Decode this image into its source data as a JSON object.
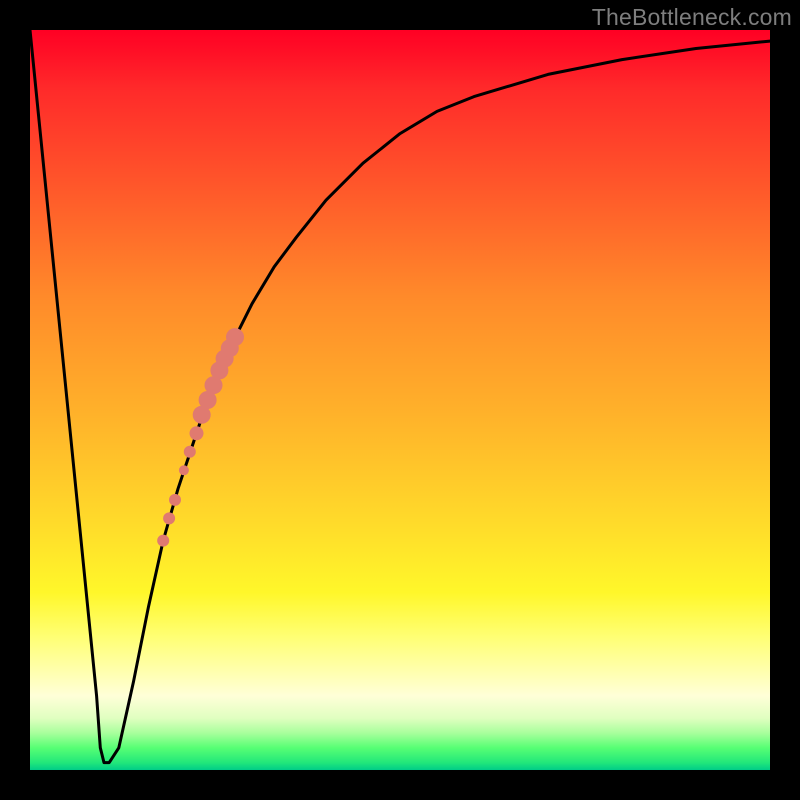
{
  "watermark": "TheBottleneck.com",
  "chart_data": {
    "type": "line",
    "title": "",
    "xlabel": "",
    "ylabel": "",
    "x_range": [
      0,
      100
    ],
    "y_range": [
      0,
      100
    ],
    "series": [
      {
        "name": "bottleneck-curve",
        "color": "#000000",
        "x": [
          0,
          2,
          5,
          8,
          9,
          9.5,
          10,
          10.7,
          12,
          14,
          16,
          18,
          20,
          22,
          24,
          26,
          28,
          30,
          33,
          36,
          40,
          45,
          50,
          55,
          60,
          70,
          80,
          90,
          100
        ],
        "y": [
          100,
          80,
          50,
          20,
          10,
          3,
          1,
          1,
          3,
          12,
          22,
          31,
          38,
          44,
          50,
          55,
          59,
          63,
          68,
          72,
          77,
          82,
          86,
          89,
          91,
          94,
          96,
          97.5,
          98.5
        ]
      }
    ],
    "highlight_points": {
      "name": "selected-range",
      "color": "#e07a70",
      "points": [
        {
          "x": 18.0,
          "y": 31,
          "r": 6
        },
        {
          "x": 18.8,
          "y": 34,
          "r": 6
        },
        {
          "x": 19.6,
          "y": 36.5,
          "r": 6
        },
        {
          "x": 20.8,
          "y": 40.5,
          "r": 5
        },
        {
          "x": 21.6,
          "y": 43,
          "r": 6
        },
        {
          "x": 22.5,
          "y": 45.5,
          "r": 7
        },
        {
          "x": 23.2,
          "y": 48,
          "r": 9
        },
        {
          "x": 24.0,
          "y": 50,
          "r": 9
        },
        {
          "x": 24.8,
          "y": 52,
          "r": 9
        },
        {
          "x": 25.6,
          "y": 54,
          "r": 9
        },
        {
          "x": 26.3,
          "y": 55.6,
          "r": 9
        },
        {
          "x": 27.0,
          "y": 57,
          "r": 9
        },
        {
          "x": 27.7,
          "y": 58.5,
          "r": 9
        }
      ]
    }
  }
}
